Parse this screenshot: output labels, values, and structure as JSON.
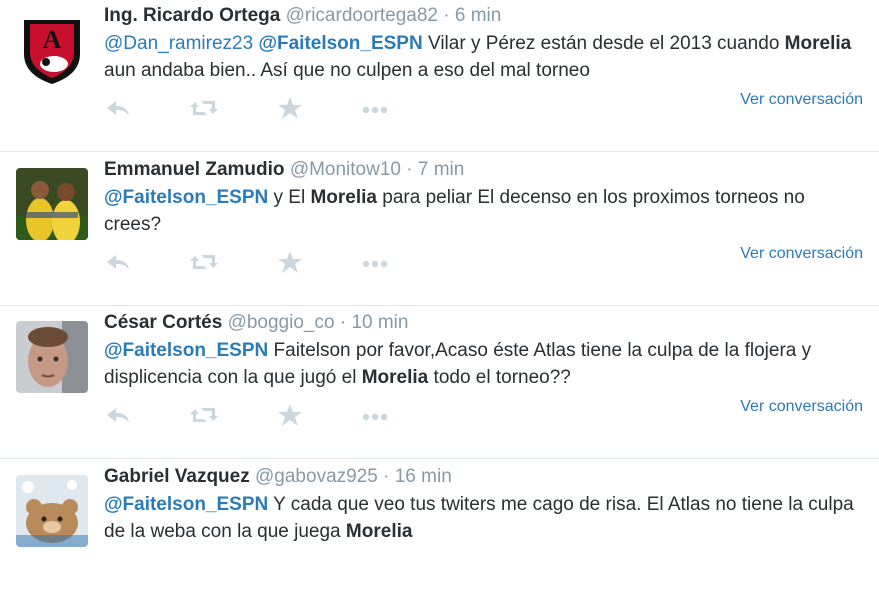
{
  "tweets": [
    {
      "fullname": "Ing. Ricardo Ortega",
      "username": "@ricardoortega82",
      "separator": "·",
      "time": "6 min",
      "mention1": "@Dan_ramirez23",
      "mention2": "@Faitelson_ESPN",
      "text_a": " Vilar y Pérez están desde el 2013 cuando ",
      "keyword": "Morelia",
      "text_b": " aun andaba bien.. Así que no culpen a eso del mal torneo",
      "convo": "Ver conversación"
    },
    {
      "fullname": "Emmanuel Zamudio",
      "username": "@Monitow10",
      "separator": "·",
      "time": "7 min",
      "mention1": "@Faitelson_ESPN",
      "text_a": " y El ",
      "keyword": "Morelia",
      "text_b": " para peliar El decenso en los proximos torneos no crees?",
      "convo": "Ver conversación"
    },
    {
      "fullname": "César Cortés",
      "username": "@boggio_co",
      "separator": "·",
      "time": "10 min",
      "mention1": "@Faitelson_ESPN",
      "text_a": " Faitelson por favor,Acaso éste Atlas tiene la culpa de la flojera y displicencia con la que jugó el ",
      "keyword": "Morelia",
      "text_b": " todo el torneo??",
      "convo": "Ver conversación"
    },
    {
      "fullname": "Gabriel Vazquez",
      "username": "@gabovaz925",
      "separator": "·",
      "time": "16 min",
      "mention1": "@Faitelson_ESPN",
      "text_a": " Y cada que veo tus twiters me cago de risa. El Atlas no tiene la culpa de la weba con la que juega ",
      "keyword": "Morelia",
      "text_b": ""
    }
  ],
  "colors": {
    "link": "#2b7bb9",
    "muted": "#8899a6",
    "icon": "#ccd6dd",
    "text": "#292f33"
  },
  "icons": [
    "reply-icon",
    "retweet-icon",
    "favorite-icon",
    "more-icon"
  ]
}
